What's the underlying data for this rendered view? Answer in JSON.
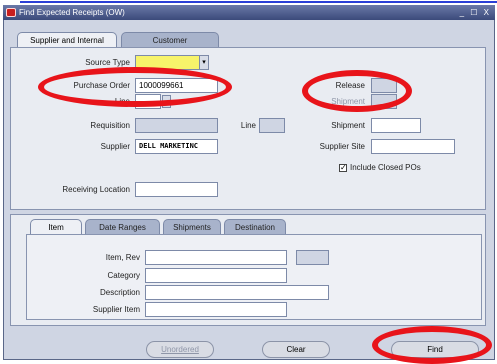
{
  "window": {
    "title": "Find Expected Receipts (OW)",
    "controls": "_ ☐ X"
  },
  "header_tabs": [
    {
      "label": "Supplier and Internal"
    },
    {
      "label": "Customer"
    }
  ],
  "fields": {
    "source_type": {
      "label": "Source Type",
      "value": ""
    },
    "purchase_order": {
      "label": "Purchase Order",
      "value": "1000099661"
    },
    "po_line": {
      "label": "Line",
      "value": ""
    },
    "requisition": {
      "label": "Requisition",
      "value": ""
    },
    "req_line": {
      "label": "Line",
      "value": ""
    },
    "supplier": {
      "label": "Supplier",
      "value": "DELL MARKETINC"
    },
    "release": {
      "label": "Release",
      "value": ""
    },
    "release_shipment": {
      "label": "Shipment",
      "value": ""
    },
    "shipment": {
      "label": "Shipment",
      "value": ""
    },
    "supplier_site": {
      "label": "Supplier Site",
      "value": ""
    },
    "include_closed": {
      "label": "Include Closed POs",
      "checked": true,
      "mark": "✓"
    },
    "receiving_location": {
      "label": "Receiving Location",
      "value": ""
    }
  },
  "detail_tabs": [
    {
      "label": "Item"
    },
    {
      "label": "Date Ranges"
    },
    {
      "label": "Shipments"
    },
    {
      "label": "Destination"
    }
  ],
  "item_fields": {
    "item_rev": {
      "label": "Item, Rev",
      "value": "",
      "rev": ""
    },
    "category": {
      "label": "Category",
      "value": ""
    },
    "description": {
      "label": "Description",
      "value": ""
    },
    "supplier_item": {
      "label": "Supplier Item",
      "value": ""
    }
  },
  "buttons": {
    "unordered": "Unordered",
    "clear": "Clear",
    "find": "Find"
  },
  "colors": {
    "highlight_ring": "#e8141a",
    "title_bar": "#3b4a7a",
    "required_field": "#f7f36a"
  }
}
